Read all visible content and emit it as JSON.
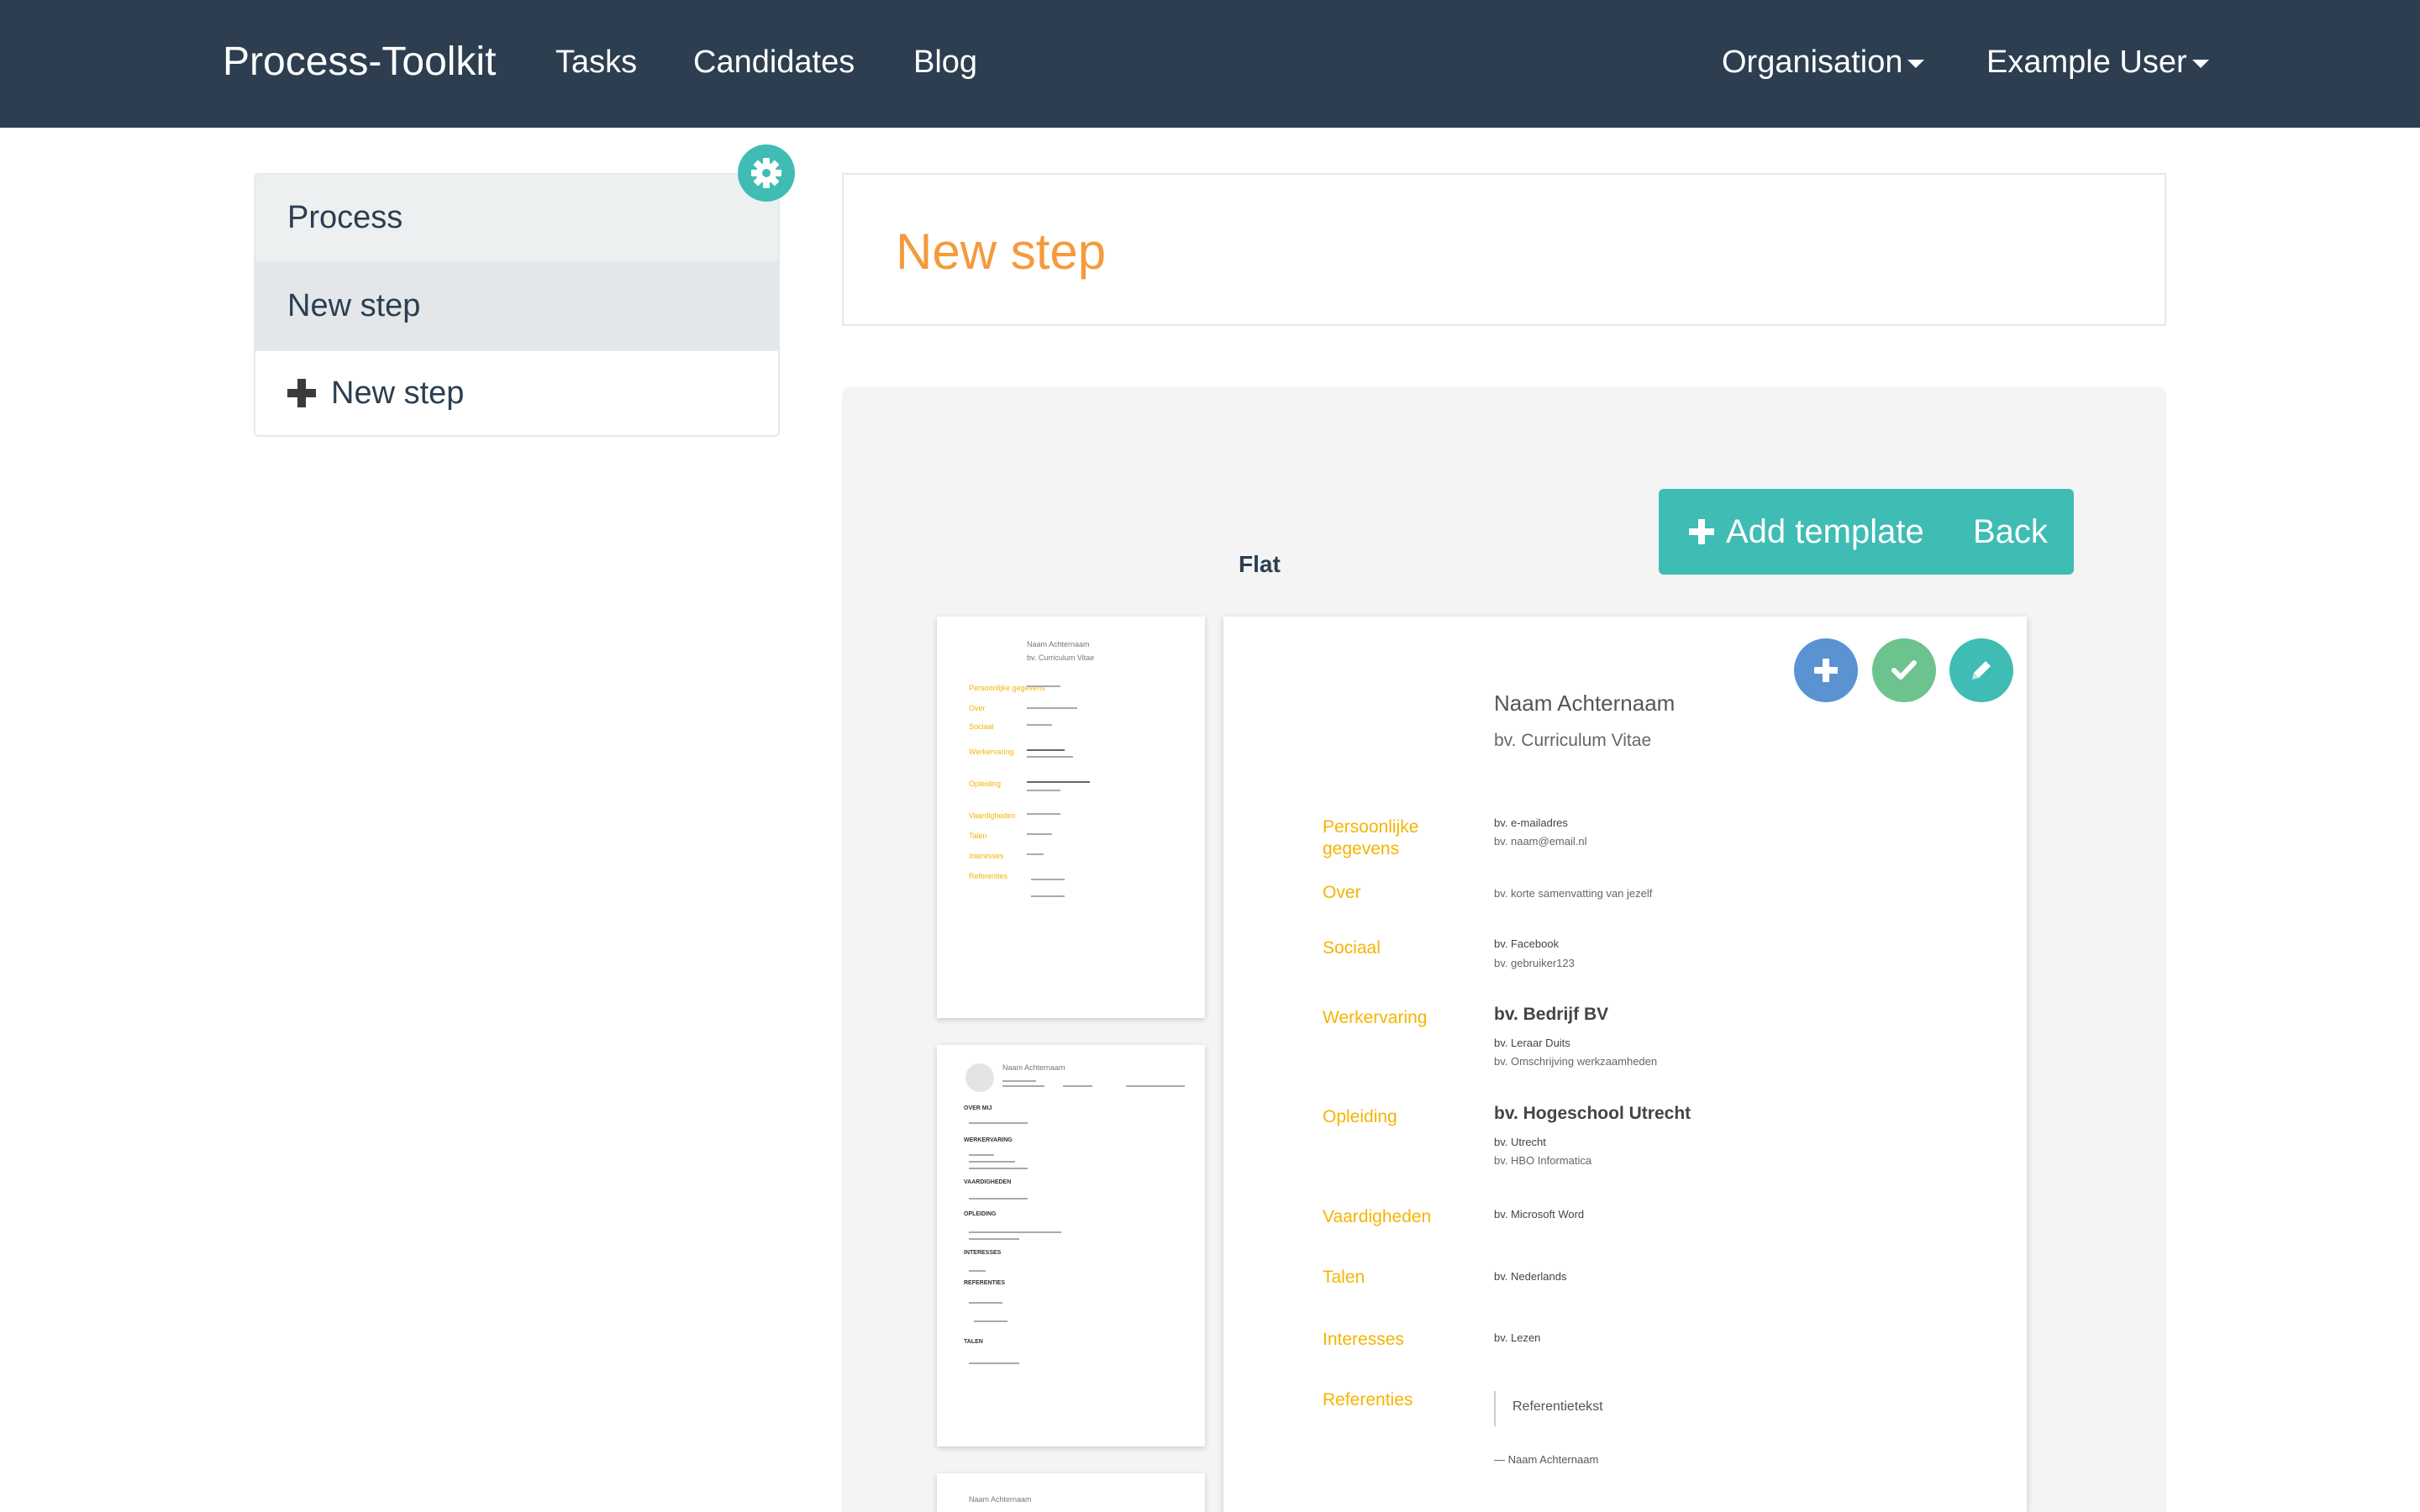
{
  "nav": {
    "brand": "Process-Toolkit",
    "links": [
      "Tasks",
      "Candidates",
      "Blog"
    ],
    "organisation": "Organisation",
    "user": "Example User"
  },
  "sidebar": {
    "header": "Process",
    "items": [
      {
        "label": "New step"
      }
    ],
    "add_label": "New step"
  },
  "step": {
    "title": "New step"
  },
  "templates": {
    "add_label": "Add template",
    "back_label": "Back",
    "current_name": "Flat",
    "thumb1": {
      "name": "Naam Achternaam",
      "sub": "bv. Curriculum Vitae",
      "sections": [
        "Persoonlijke gegevens",
        "Over",
        "Sociaal",
        "Werkervaring",
        "Opleiding",
        "Vaardigheden",
        "Talen",
        "Interesses",
        "Referenties"
      ]
    },
    "thumb2": {
      "name": "Naam Achternaam",
      "headings": [
        "OVER MIJ",
        "WERKERVARING",
        "VAARDIGHEDEN",
        "OPLEIDING",
        "INTERESSES",
        "REFERENTIES",
        "TALEN"
      ]
    },
    "thumb3": {
      "name": "Naam Achternaam"
    }
  },
  "cv": {
    "name": "Naam Achternaam",
    "subtitle": "bv. Curriculum Vitae",
    "personal_label": "Persoonlijke gegevens",
    "personal_v1": "bv. e-mailadres",
    "personal_v2": "bv. naam@email.nl",
    "about_label": "Over",
    "about_v": "bv. korte samenvatting van jezelf",
    "social_label": "Sociaal",
    "social_v1": "bv. Facebook",
    "social_v2": "bv. gebruiker123",
    "work_label": "Werkervaring",
    "work_company": "bv. Bedrijf BV",
    "work_v1": "bv. Leraar Duits",
    "work_v2": "bv. Omschrijving werkzaamheden",
    "edu_label": "Opleiding",
    "edu_school": "bv. Hogeschool Utrecht",
    "edu_v1": "bv. Utrecht",
    "edu_v2": "bv. HBO Informatica",
    "skills_label": "Vaardigheden",
    "skills_v": "bv. Microsoft Word",
    "lang_label": "Talen",
    "lang_v": "bv. Nederlands",
    "interests_label": "Interesses",
    "interests_v": "bv. Lezen",
    "refs_label": "Referenties",
    "refs_quote": "Referentietekst",
    "refs_author": "— Naam Achternaam"
  },
  "colors": {
    "navbar": "#2c3e50",
    "accent_teal": "#3fbcb4",
    "title_orange": "#f59a3c",
    "cv_section": "#f5b400",
    "btn_blue": "#5b92d1",
    "btn_green": "#6dc38d"
  },
  "icons": {
    "gear": "gear-icon",
    "plus": "plus-icon",
    "check": "check-icon",
    "pencil": "pencil-icon"
  }
}
